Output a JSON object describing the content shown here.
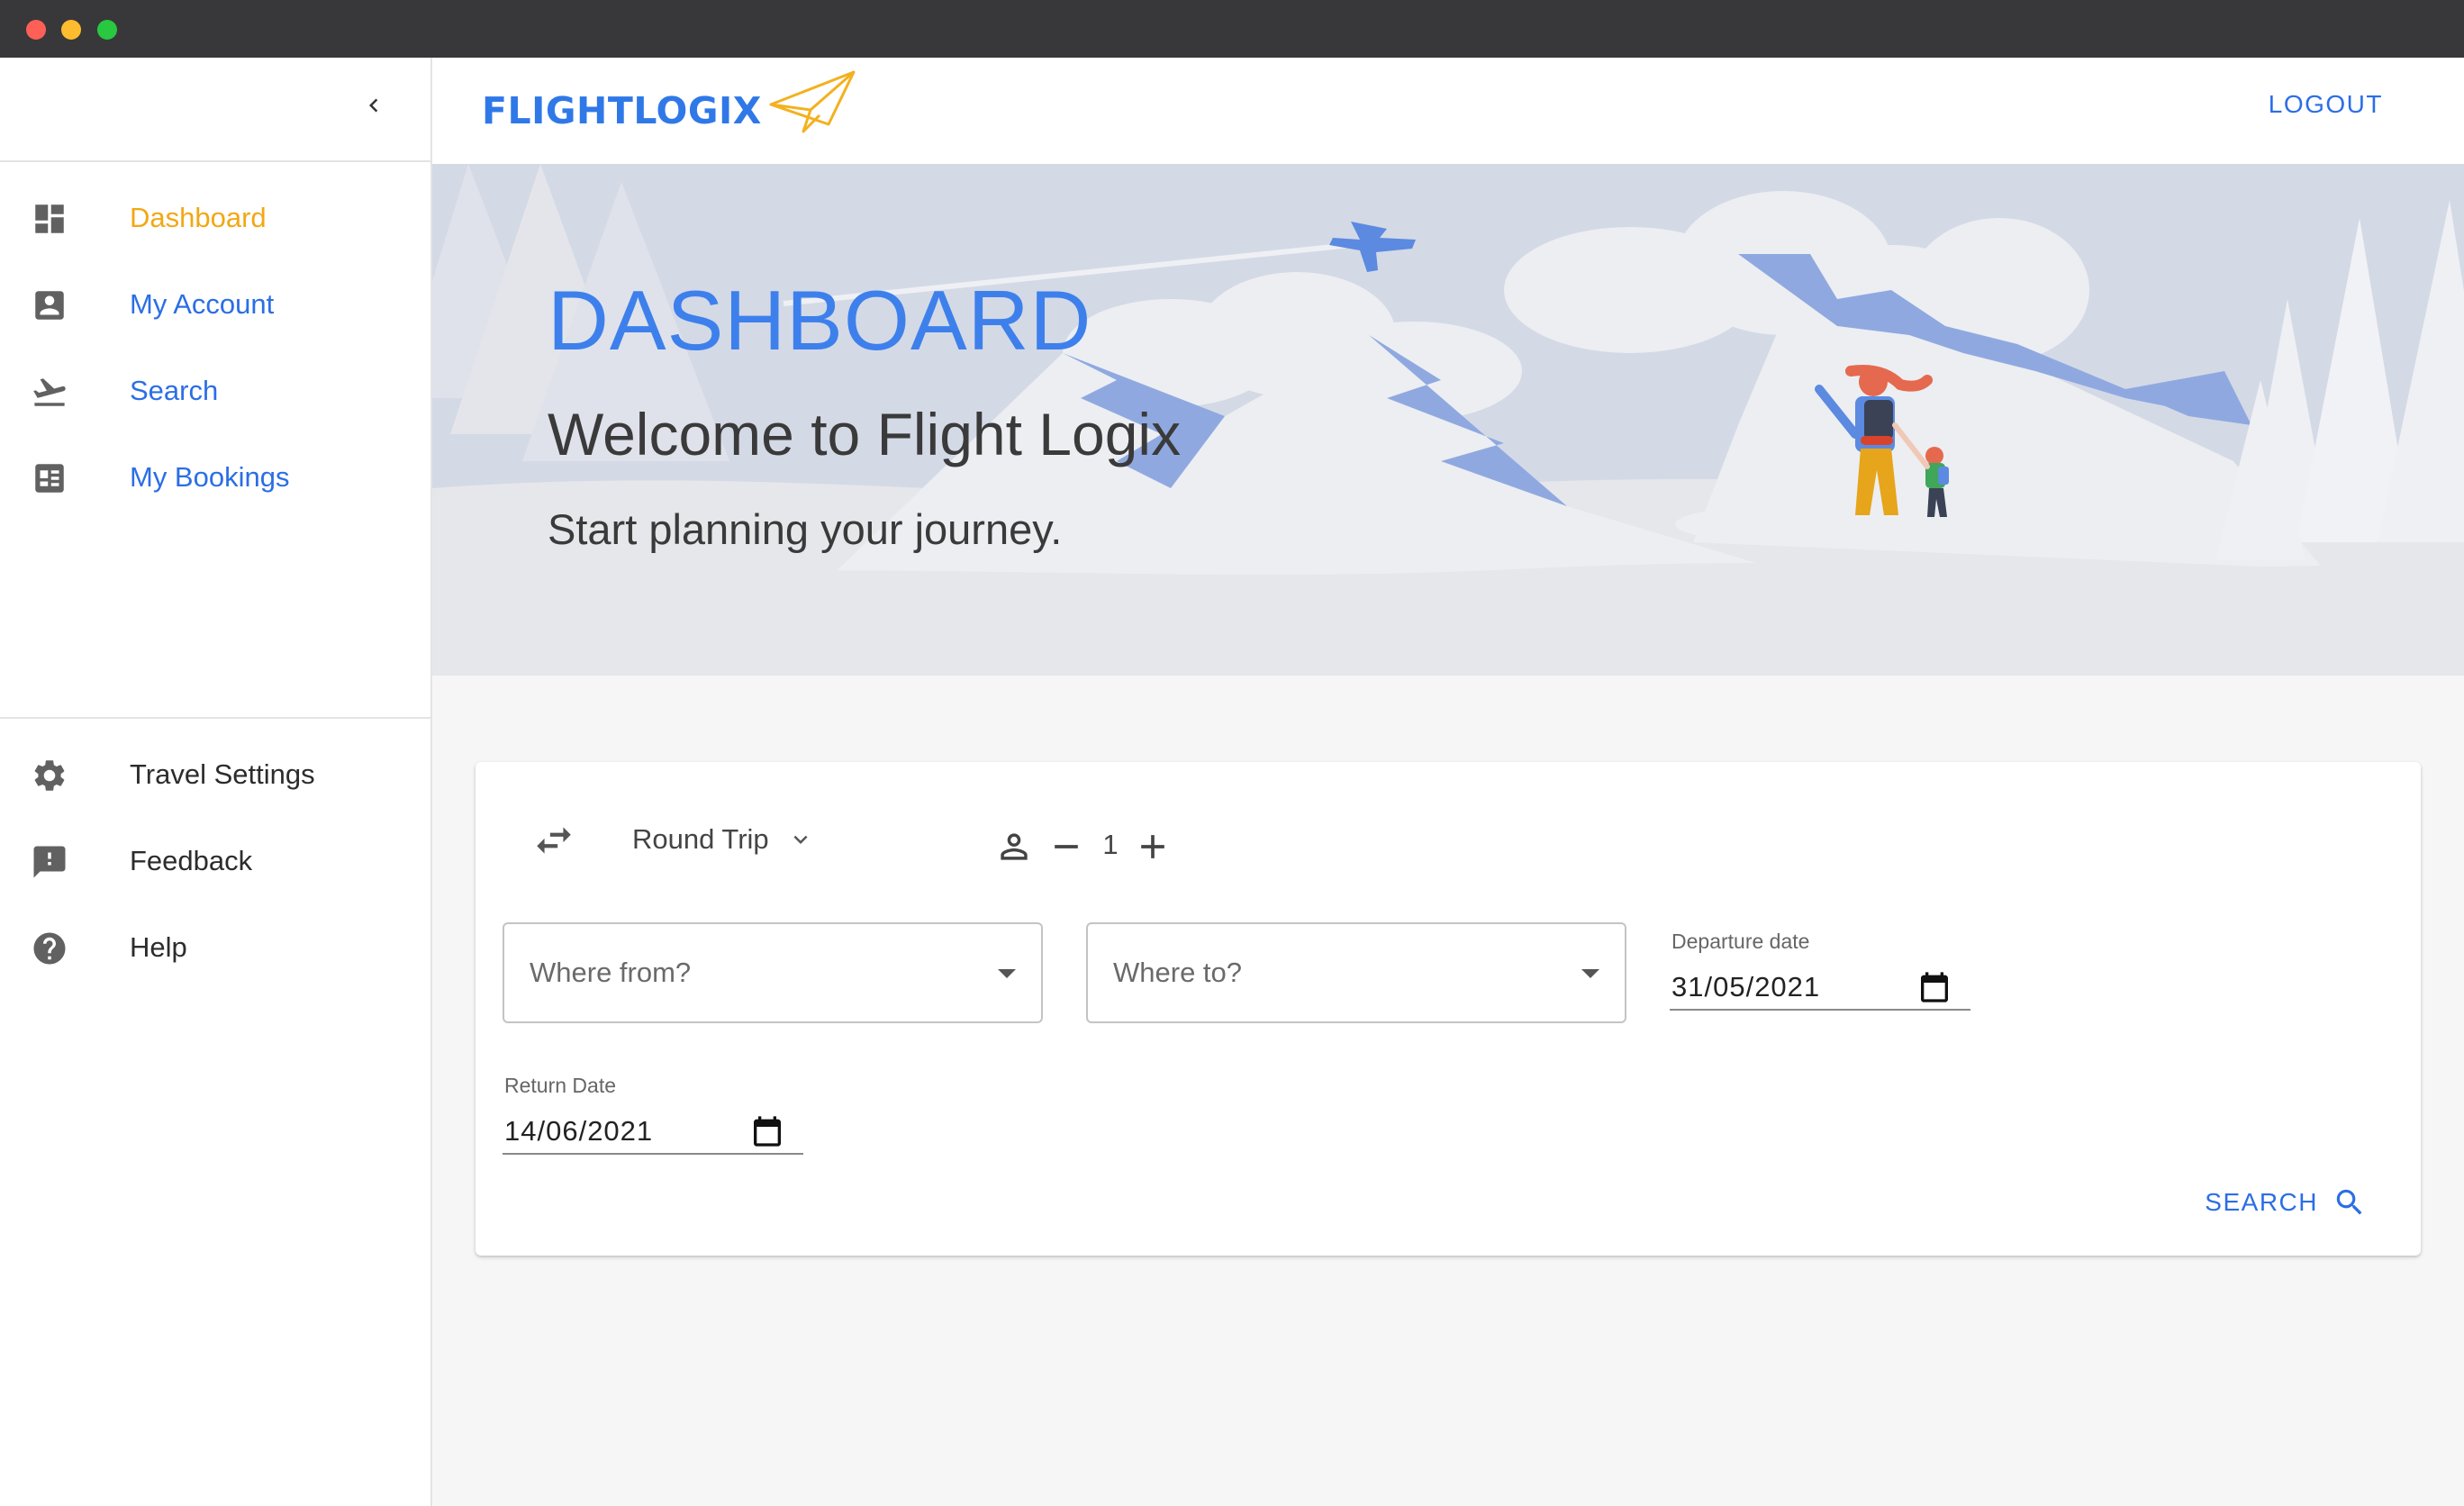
{
  "sidebar": {
    "collapse_icon": "chevron-left-icon",
    "primary_items": [
      {
        "label": "Dashboard",
        "icon": "dashboard-icon",
        "active": true
      },
      {
        "label": "My Account",
        "icon": "account-box-icon",
        "active": false
      },
      {
        "label": "Search",
        "icon": "flight-takeoff-icon",
        "active": false
      },
      {
        "label": "My Bookings",
        "icon": "bookings-list-icon",
        "active": false
      }
    ],
    "secondary_items": [
      {
        "label": "Travel Settings",
        "icon": "gear-icon"
      },
      {
        "label": "Feedback",
        "icon": "feedback-icon"
      },
      {
        "label": "Help",
        "icon": "help-icon"
      }
    ]
  },
  "header": {
    "logo_text": "FLIGHTLOGIX",
    "logo_icon": "paper-plane-icon",
    "logout_label": "LOGOUT"
  },
  "hero": {
    "title": "DASHBOARD",
    "welcome": "Welcome to Flight Logix",
    "subtitle": "Start planning your journey."
  },
  "search_form": {
    "trip_type": "Round Trip",
    "passengers": "1",
    "from_placeholder": "Where from?",
    "to_placeholder": "Where to?",
    "departure_label": "Departure date",
    "departure_value": "31/05/2021",
    "return_label": "Return Date",
    "return_value": "14/06/2021",
    "search_label": "SEARCH"
  },
  "colors": {
    "accent_blue": "#2b6ee6",
    "active_orange": "#f3a714",
    "hero_bg": "#e6e7ea",
    "main_bg": "#f6f6f6"
  }
}
